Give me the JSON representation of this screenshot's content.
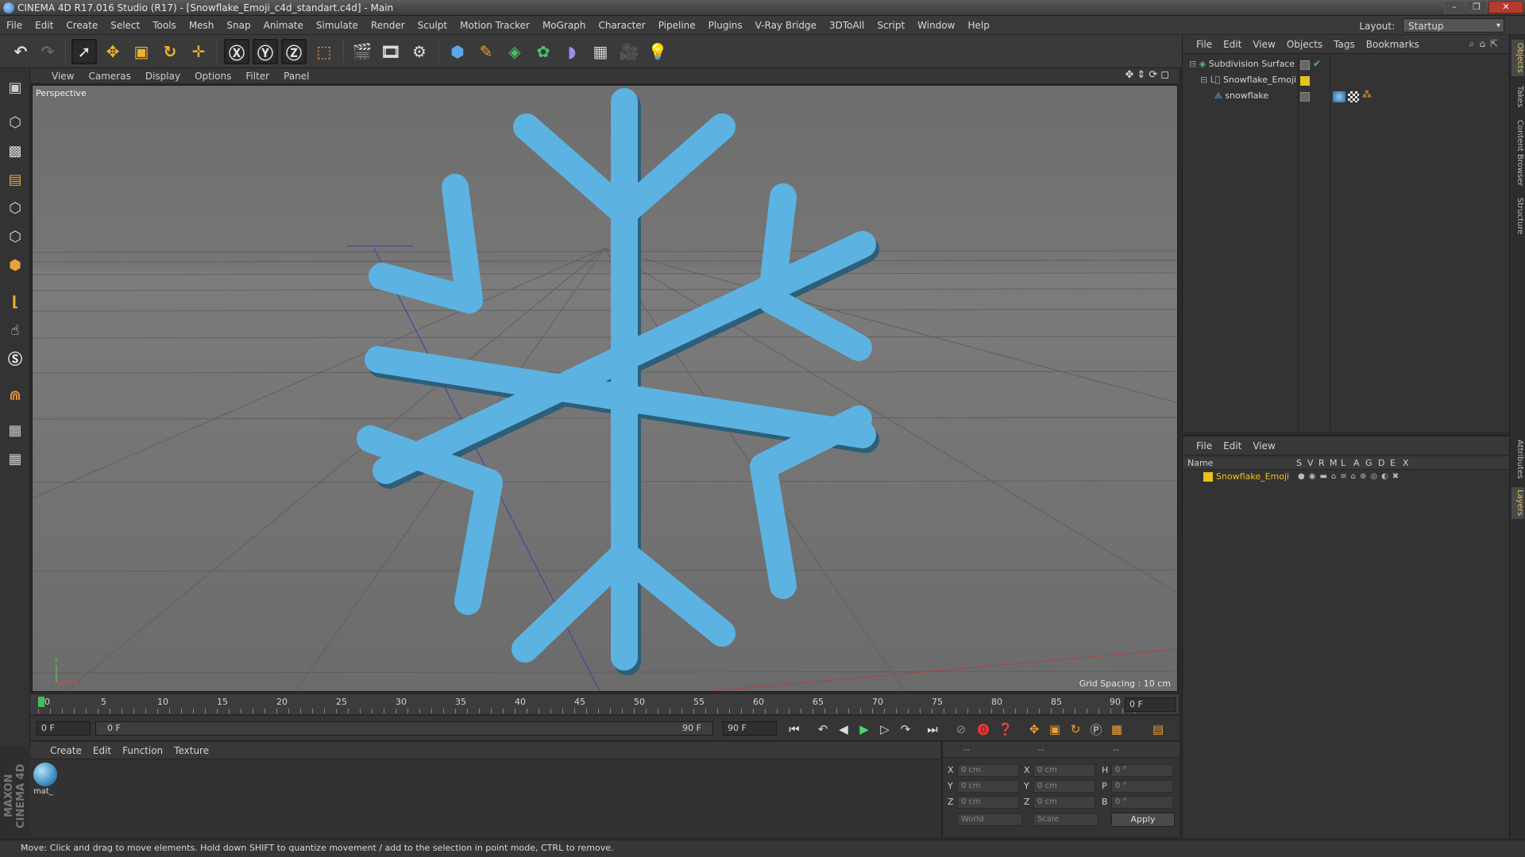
{
  "window": {
    "title": "CINEMA 4D R17.016 Studio (R17) - [Snowflake_Emoji_c4d_standart.c4d] - Main",
    "controls": [
      "–",
      "❐",
      "✕"
    ]
  },
  "menubar": {
    "items": [
      "File",
      "Edit",
      "Create",
      "Select",
      "Tools",
      "Mesh",
      "Snap",
      "Animate",
      "Simulate",
      "Render",
      "Sculpt",
      "Motion Tracker",
      "MoGraph",
      "Character",
      "Pipeline",
      "Plugins",
      "V-Ray Bridge",
      "3DToAll",
      "Script",
      "Window",
      "Help"
    ],
    "layout_label": "Layout:",
    "layout_value": "Startup"
  },
  "viewport": {
    "menu": [
      "View",
      "Cameras",
      "Display",
      "Options",
      "Filter",
      "Panel"
    ],
    "label": "Perspective",
    "grid_spacing": "Grid Spacing : 10 cm",
    "object_color": "#5cb3e2"
  },
  "objects_panel": {
    "menu": [
      "File",
      "Edit",
      "View",
      "Objects",
      "Tags",
      "Bookmarks"
    ],
    "rows": [
      {
        "name": "Subdivision Surface"
      },
      {
        "name": "Snowflake_Emoji"
      },
      {
        "name": "snowflake"
      }
    ]
  },
  "layers_panel": {
    "menu": [
      "File",
      "Edit",
      "View"
    ],
    "header": {
      "name": "Name",
      "cols": [
        "S",
        "V",
        "R",
        "M",
        "L",
        "A",
        "G",
        "D",
        "E",
        "X"
      ]
    },
    "rows": [
      {
        "name": "Snowflake_Emoji",
        "color": "#e8c21a"
      }
    ]
  },
  "side_tabs": [
    "Objects",
    "Takes",
    "Content Browser",
    "Structure",
    "Attributes",
    "Layers"
  ],
  "timeline": {
    "ticks": [
      "0",
      "5",
      "10",
      "15",
      "20",
      "25",
      "30",
      "35",
      "40",
      "45",
      "50",
      "55",
      "60",
      "65",
      "70",
      "75",
      "80",
      "85",
      "90"
    ],
    "current_frame": "0 F",
    "start_field": "0 F",
    "range_start": "0 F",
    "range_end": "90 F",
    "end_field": "90 F"
  },
  "material_panel": {
    "menu": [
      "Create",
      "Edit",
      "Function",
      "Texture"
    ],
    "material_name": "mat_"
  },
  "coordinates": {
    "headers": [
      "--",
      "--",
      "--"
    ],
    "rows": [
      {
        "l1": "X",
        "v1": "0 cm",
        "l2": "X",
        "v2": "0 cm",
        "l3": "H",
        "v3": "0 °"
      },
      {
        "l1": "Y",
        "v1": "0 cm",
        "l2": "Y",
        "v2": "0 cm",
        "l3": "P",
        "v3": "0 °"
      },
      {
        "l1": "Z",
        "v1": "0 cm",
        "l2": "Z",
        "v2": "0 cm",
        "l3": "B",
        "v3": "0 °"
      }
    ],
    "space": "World",
    "mode": "Scale",
    "apply": "Apply"
  },
  "branding": "MAXON CINEMA 4D",
  "status": "Move: Click and drag to move elements. Hold down SHIFT to quantize movement / add to the selection in point mode, CTRL to remove."
}
